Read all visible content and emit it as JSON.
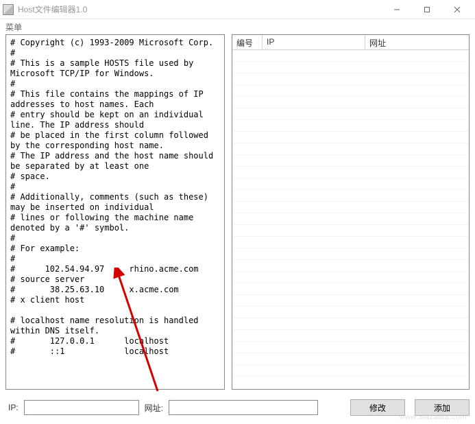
{
  "window": {
    "title": "Host文件编辑器1.0"
  },
  "menubar": {
    "menu_label": "菜单"
  },
  "hosts_text": "# Copyright (c) 1993-2009 Microsoft Corp.\n#\n# This is a sample HOSTS file used by Microsoft TCP/IP for Windows.\n#\n# This file contains the mappings of IP addresses to host names. Each\n# entry should be kept on an individual line. The IP address should\n# be placed in the first column followed by the corresponding host name.\n# The IP address and the host name should be separated by at least one\n# space.\n#\n# Additionally, comments (such as these) may be inserted on individual\n# lines or following the machine name denoted by a '#' symbol.\n#\n# For example:\n#\n#      102.54.94.97     rhino.acme.com\n# source server\n#       38.25.63.10     x.acme.com\n# x client host\n\n# localhost name resolution is handled within DNS itself.\n#\t127.0.0.1      localhost\n#\t::1            localhost",
  "table": {
    "columns": {
      "col1": "编号",
      "col2": "IP",
      "col3": "网址"
    },
    "rows": []
  },
  "form": {
    "ip_label": "IP:",
    "url_label": "网址:",
    "ip_value": "",
    "url_value": "",
    "modify_label": "修改",
    "add_label": "添加"
  },
  "watermark": "www.xiazaiba.com"
}
